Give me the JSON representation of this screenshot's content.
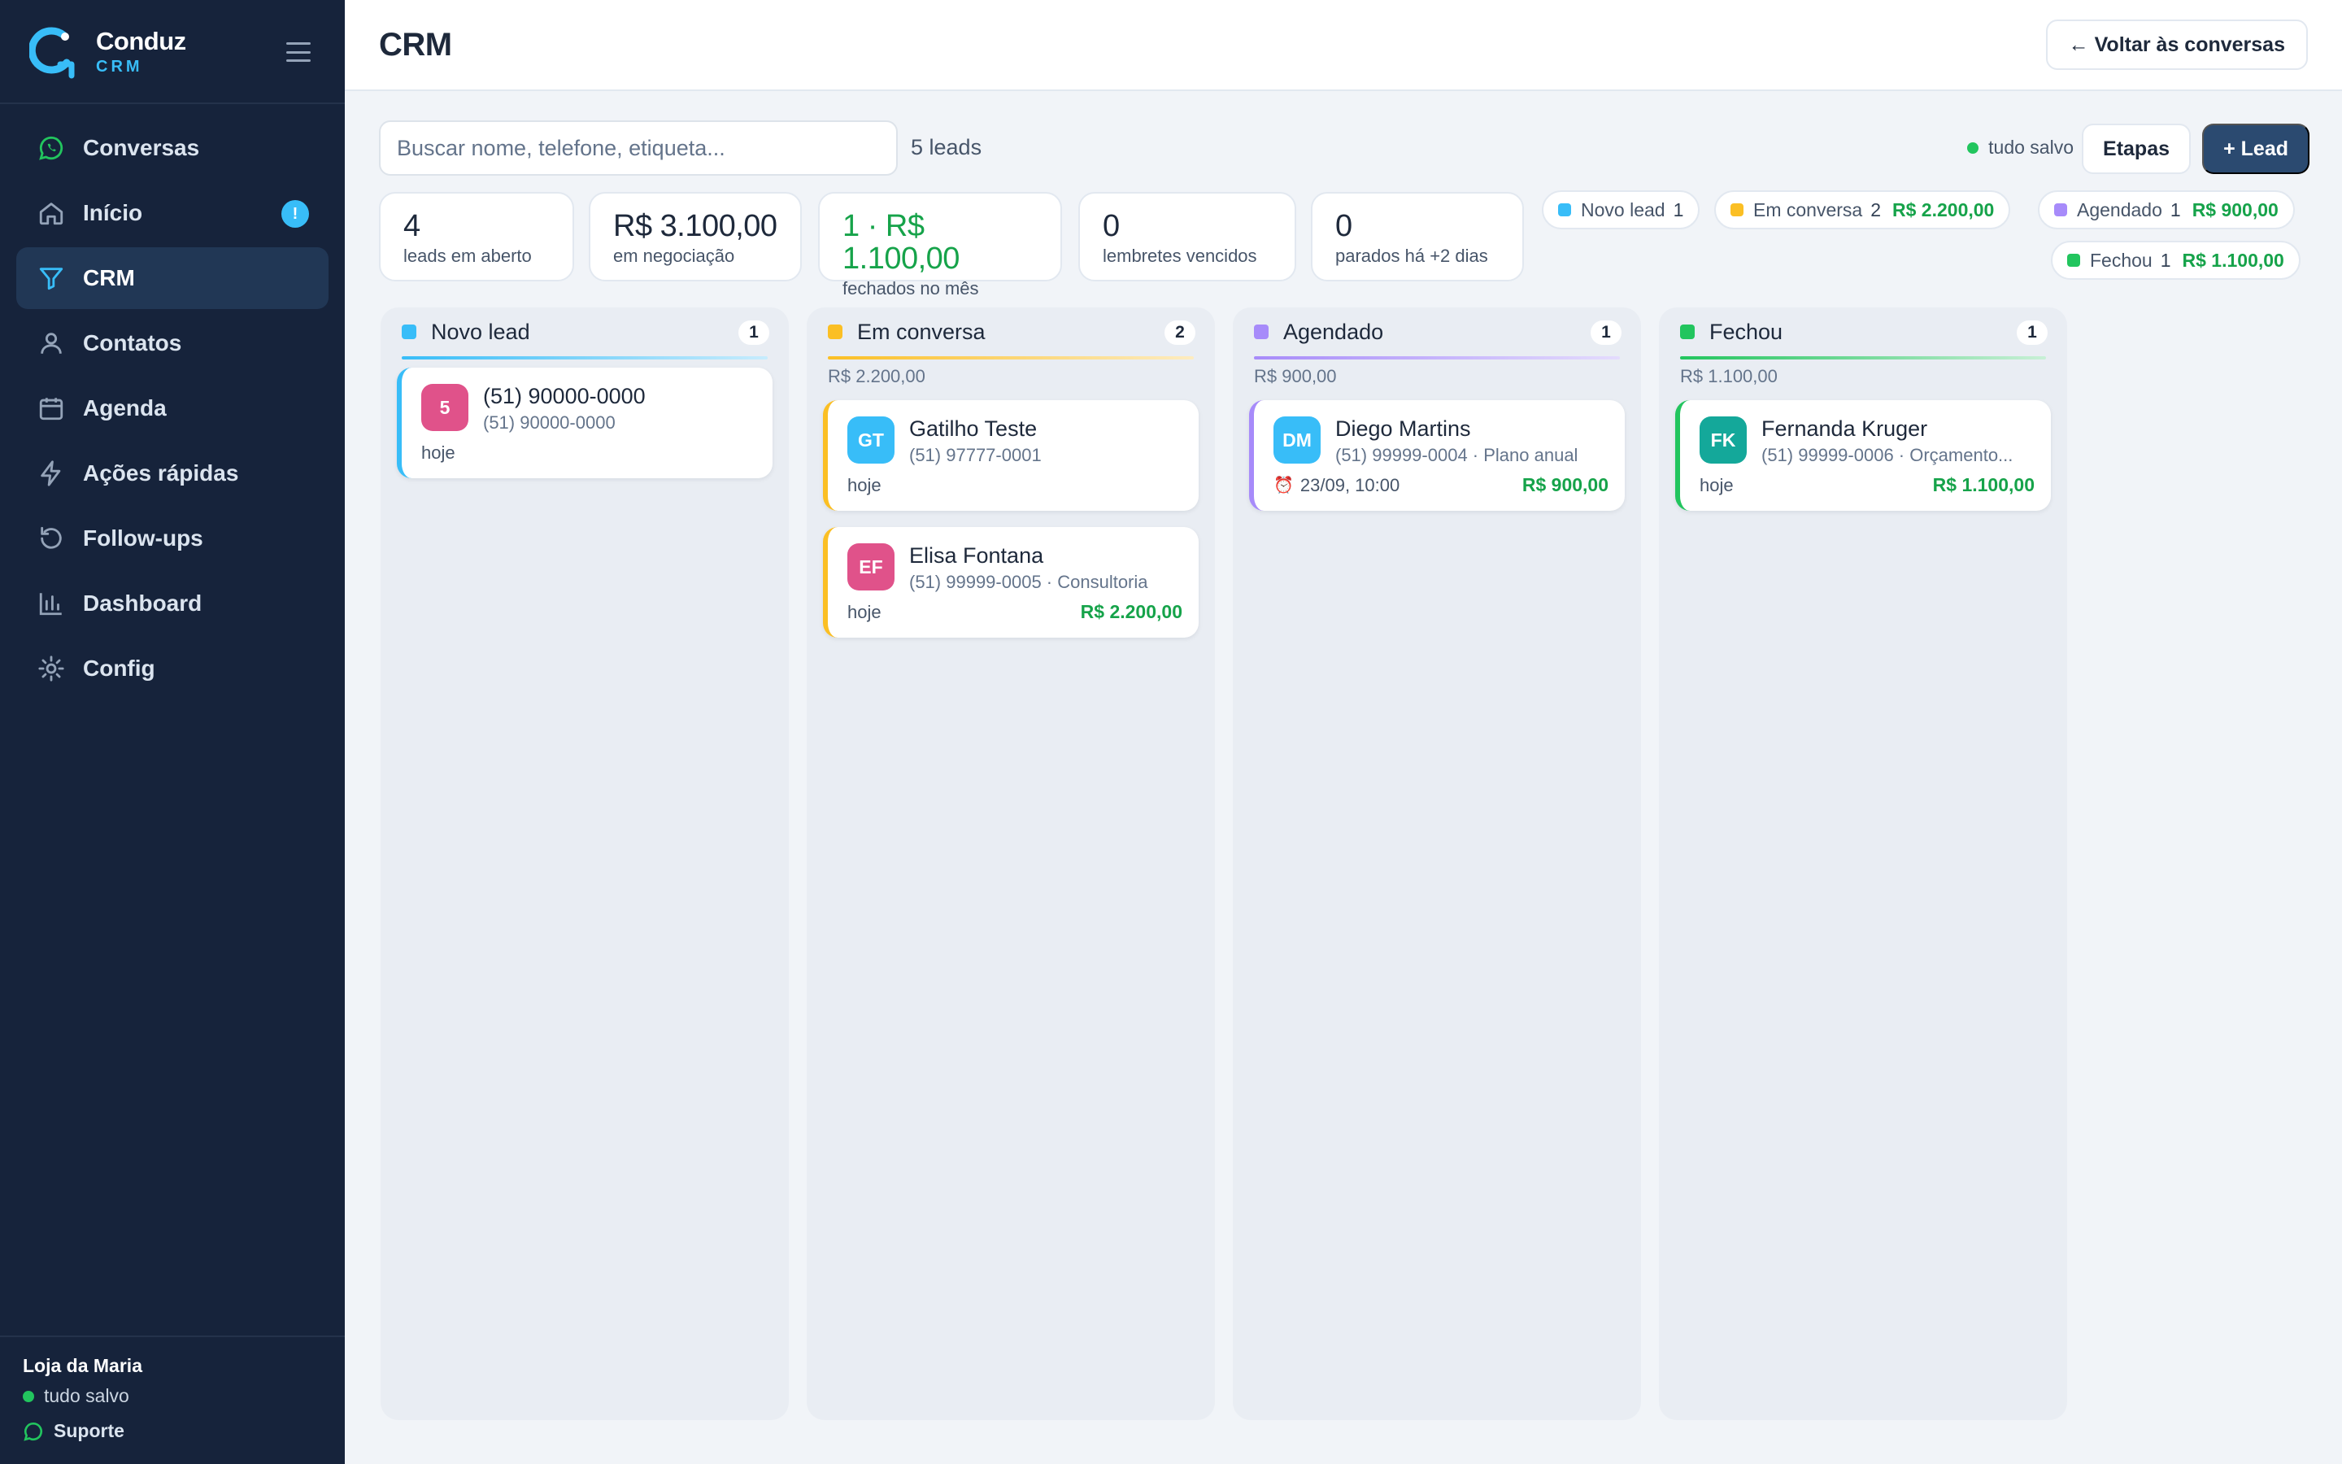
{
  "brand": {
    "name": "Conduz",
    "sub": "CRM"
  },
  "nav": [
    {
      "label": "Conversas",
      "icon": "whatsapp-icon"
    },
    {
      "label": "Início",
      "icon": "home-icon",
      "badge": "!"
    },
    {
      "label": "CRM",
      "icon": "funnel-icon",
      "active": true
    },
    {
      "label": "Contatos",
      "icon": "user-icon"
    },
    {
      "label": "Agenda",
      "icon": "calendar-icon"
    },
    {
      "label": "Ações rápidas",
      "icon": "bolt-icon"
    },
    {
      "label": "Follow-ups",
      "icon": "history-icon"
    },
    {
      "label": "Dashboard",
      "icon": "bar-chart-icon"
    },
    {
      "label": "Config",
      "icon": "gear-icon"
    }
  ],
  "footer": {
    "store": "Loja da Maria",
    "status": "tudo salvo",
    "support": "Suporte"
  },
  "header": {
    "title": "CRM",
    "back": "← Voltar às conversas"
  },
  "toolbar": {
    "search_placeholder": "Buscar nome, telefone, etiqueta...",
    "lead_count": "5 leads",
    "saved": "tudo salvo",
    "etapas": "Etapas",
    "add_lead": "+ Lead"
  },
  "stats": [
    {
      "value": "4",
      "label": "leads em aberto"
    },
    {
      "value": "R$ 3.100,00",
      "label": "em negociação"
    },
    {
      "value": "1 · R$ 1.100,00",
      "label": "fechados no mês"
    },
    {
      "value": "0",
      "label": "lembretes vencidos"
    },
    {
      "value": "0",
      "label": "parados há +2 dias"
    }
  ],
  "chips": [
    {
      "name": "Novo lead",
      "count": "1",
      "amount": ""
    },
    {
      "name": "Em conversa",
      "count": "2",
      "amount": "R$ 2.200,00"
    },
    {
      "name": "Agendado",
      "count": "1",
      "amount": "R$ 900,00"
    },
    {
      "name": "Fechou",
      "count": "1",
      "amount": "R$ 1.100,00"
    }
  ],
  "colors": {
    "novo": "#38bdf8",
    "conversa": "#fbbf24",
    "agendado": "#a78bfa",
    "fechou": "#22c55e",
    "accent": "#2b4a70"
  },
  "columns": [
    {
      "title": "Novo lead",
      "count": "1",
      "total": "",
      "cards": [
        {
          "initials": "5",
          "name": "(51) 90000-0000",
          "sub": "(51) 90000-0000",
          "date": "hoje",
          "amount": ""
        }
      ]
    },
    {
      "title": "Em conversa",
      "count": "2",
      "total": "R$ 2.200,00",
      "cards": [
        {
          "initials": "GT",
          "name": "Gatilho Teste",
          "sub": "(51) 97777-0001",
          "date": "hoje",
          "amount": ""
        },
        {
          "initials": "EF",
          "name": "Elisa Fontana",
          "sub": "(51) 99999-0005 · Consultoria",
          "date": "hoje",
          "amount": "R$ 2.200,00"
        }
      ]
    },
    {
      "title": "Agendado",
      "count": "1",
      "total": "R$ 900,00",
      "cards": [
        {
          "initials": "DM",
          "name": "Diego Martins",
          "sub": "(51) 99999-0004 · Plano anual",
          "date": "23/09, 10:00",
          "amount": "R$ 900,00"
        }
      ]
    },
    {
      "title": "Fechou",
      "count": "1",
      "total": "R$ 1.100,00",
      "cards": [
        {
          "initials": "FK",
          "name": "Fernanda Kruger",
          "sub": "(51) 99999-0006 · Orçamento...",
          "date": "hoje",
          "amount": "R$ 1.100,00"
        }
      ]
    }
  ]
}
